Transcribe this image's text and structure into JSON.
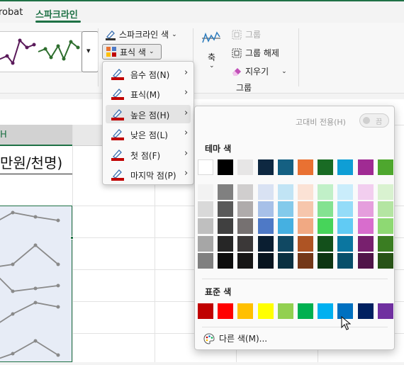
{
  "tabs": {
    "acrobat": "robat",
    "sparkline": "스파크라인"
  },
  "ribbon": {
    "sparkline_color": "스파크라인 색",
    "marker_color": "표식 색",
    "axis": "축",
    "group": "그룹",
    "ungroup": "그룹 해제",
    "clear": "지우기",
    "group_section_label": "그룹"
  },
  "sheet": {
    "column_header": "H",
    "title_fragment": "만원/천명)"
  },
  "marker_menu": {
    "items": [
      {
        "label": "음수 점(N)",
        "color": "#c00000",
        "highlighted": false
      },
      {
        "label": "표식(M)",
        "color": "#c00000",
        "highlighted": false
      },
      {
        "label": "높은 점(H)",
        "color": "#c00000",
        "highlighted": true
      },
      {
        "label": "낮은 점(L)",
        "color": "#c00000",
        "highlighted": false
      },
      {
        "label": "첫 점(F)",
        "color": "#c00000",
        "highlighted": false
      },
      {
        "label": "마지막 점(P)",
        "color": "#c00000",
        "highlighted": false
      }
    ]
  },
  "palette": {
    "high_contrast_label": "고대비 전용(H)",
    "toggle_state": "끔",
    "theme_colors_label": "테마 색",
    "standard_colors_label": "표준 색",
    "more_colors_label": "다른 색(M)...",
    "theme_row": [
      "#ffffff",
      "#000000",
      "#e7e6e6",
      "#0e2841",
      "#156082",
      "#e97132",
      "#196b24",
      "#0f9ed5",
      "#a02b93",
      "#4ea72e"
    ],
    "theme_shades": [
      [
        "#f2f2f2",
        "#d9d9d9",
        "#bfbfbf",
        "#a6a6a6",
        "#808080"
      ],
      [
        "#808080",
        "#595959",
        "#404040",
        "#262626",
        "#0d0d0d"
      ],
      [
        "#d0cece",
        "#afabab",
        "#767171",
        "#3b3838",
        "#171616"
      ],
      [
        "#d9e2f3",
        "#a7c0e8",
        "#4e79c6",
        "#0a1e31",
        "#07141f"
      ],
      [
        "#c1e4f5",
        "#83caeb",
        "#45b0e1",
        "#104862",
        "#0a3041"
      ],
      [
        "#fbe2d5",
        "#f6c6ac",
        "#f1a983",
        "#ae5424",
        "#743818"
      ],
      [
        "#c1f0c8",
        "#84e291",
        "#47d45a",
        "#13501b",
        "#0d3512"
      ],
      [
        "#caedfb",
        "#94dcf8",
        "#61cbf4",
        "#0b76a0",
        "#074f6a"
      ],
      [
        "#f2ceef",
        "#e59edd",
        "#d86dcd",
        "#78206e",
        "#501549"
      ],
      [
        "#d9f2d0",
        "#b4e5a2",
        "#8ed973",
        "#3a7d22",
        "#275317"
      ]
    ],
    "standard_row": [
      "#c00000",
      "#ff0000",
      "#ffc000",
      "#ffff00",
      "#92d050",
      "#00b050",
      "#00b0f0",
      "#0070c0",
      "#002060",
      "#7030a0"
    ]
  }
}
